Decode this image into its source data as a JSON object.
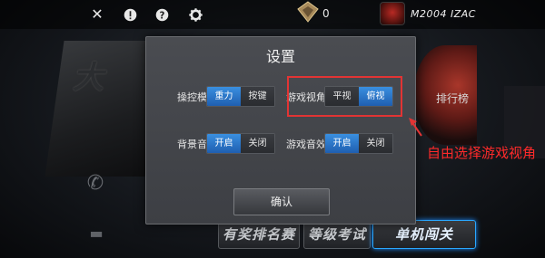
{
  "topbar": {
    "count": "0",
    "player_name": "M2004 IZAC",
    "icons": [
      "close-icon",
      "alert-icon",
      "help-icon",
      "gear-icon"
    ]
  },
  "background": {
    "left_title": "大",
    "right_badge": "排行榜"
  },
  "dialog": {
    "title": "设置",
    "options": [
      {
        "label": "操控模式",
        "choices": [
          "重力",
          "按键"
        ],
        "selected": 0
      },
      {
        "label": "游戏视角",
        "choices": [
          "平视",
          "俯视"
        ],
        "selected": 1
      },
      {
        "label": "背景音乐",
        "choices": [
          "开启",
          "关闭"
        ],
        "selected": 0
      },
      {
        "label": "游戏音效",
        "choices": [
          "开启",
          "关闭"
        ],
        "selected": 0
      }
    ],
    "confirm_label": "确认"
  },
  "bottom_menu": {
    "tab_award": "有奖排名赛",
    "tab_level": "等级考试",
    "tab_single": "单机闯关"
  },
  "annotation": {
    "text": "自由选择游戏视角",
    "color": "#ff2a2a"
  },
  "colors": {
    "selected": "#2f7fd4",
    "highlight": "#e23434"
  }
}
